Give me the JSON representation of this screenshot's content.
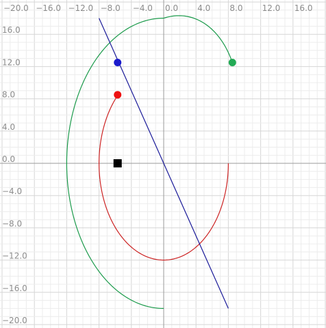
{
  "chart_data": {
    "type": "scatter",
    "title": "",
    "xlabel": "",
    "ylabel": "",
    "xlim": [
      -20.0,
      20.0
    ],
    "ylim": [
      -20.0,
      18.0
    ],
    "grid": true,
    "minor_grid_step": 1,
    "major_grid_step": 4,
    "x_ticks": [
      {
        "value": -20,
        "label": "−20.0"
      },
      {
        "value": -16,
        "label": "−16.0"
      },
      {
        "value": -12,
        "label": "−12.0"
      },
      {
        "value": -8,
        "label": "−8.0"
      },
      {
        "value": -4,
        "label": "−4.0"
      },
      {
        "value": 0,
        "label": "0.0"
      },
      {
        "value": 4,
        "label": "4.0"
      },
      {
        "value": 8,
        "label": "8.0"
      },
      {
        "value": 12,
        "label": "12.0"
      },
      {
        "value": 16,
        "label": "16.0"
      }
    ],
    "y_ticks": [
      {
        "value": 16,
        "label": "16.0"
      },
      {
        "value": 12,
        "label": "12.0"
      },
      {
        "value": 8,
        "label": "8.0"
      },
      {
        "value": 4,
        "label": "4.0"
      },
      {
        "value": 0,
        "label": "0.0"
      },
      {
        "value": -4,
        "label": "−4.0"
      },
      {
        "value": -8,
        "label": "−8.0"
      },
      {
        "value": -12,
        "label": "−12.0"
      },
      {
        "value": -16,
        "label": "−16.0"
      },
      {
        "value": -20,
        "label": "−20.0"
      }
    ],
    "curves": [
      {
        "id": "green-arc",
        "shape": "elliptical-arc",
        "color": "#1a9a4a",
        "center": [
          0,
          0
        ],
        "rx": 12.0,
        "ry": 18.0,
        "from_angle_deg": 90,
        "to_angle_deg": 270,
        "sweep": "counterclockwise",
        "tail": {
          "to": [
            8.5,
            12.5
          ],
          "via_angle_start_deg": 90,
          "via_angle_end_deg": 30
        }
      },
      {
        "id": "red-arc",
        "shape": "elliptical-arc",
        "color": "#cc2222",
        "center": [
          0,
          0
        ],
        "rx": 8.0,
        "ry": 12.0,
        "from_angle_deg": 0,
        "to_angle_deg": 135,
        "sweep": "clockwise-through-bottom",
        "start_point": [
          8.0,
          0.0
        ],
        "end_point": [
          -5.7,
          8.5
        ]
      },
      {
        "id": "blue-line",
        "shape": "line",
        "color": "#1a1a99",
        "from": [
          -8.0,
          18.0
        ],
        "to": [
          8.0,
          -18.0
        ]
      }
    ],
    "points": [
      {
        "id": "blue-point",
        "x": -5.7,
        "y": 12.5,
        "color": "#1a1acc",
        "marker": "circle"
      },
      {
        "id": "red-point",
        "x": -5.7,
        "y": 8.5,
        "color": "#ee1111",
        "marker": "circle"
      },
      {
        "id": "green-point",
        "x": 8.5,
        "y": 12.5,
        "color": "#22aa55",
        "marker": "circle"
      },
      {
        "id": "black-square",
        "x": -5.7,
        "y": 0.0,
        "color": "#000000",
        "marker": "square"
      }
    ],
    "colors": {
      "minor_grid": "#ececec",
      "major_grid": "#d6d6d6",
      "axis": "#9a9a9a",
      "tick_text": "#8c8c8c"
    }
  }
}
